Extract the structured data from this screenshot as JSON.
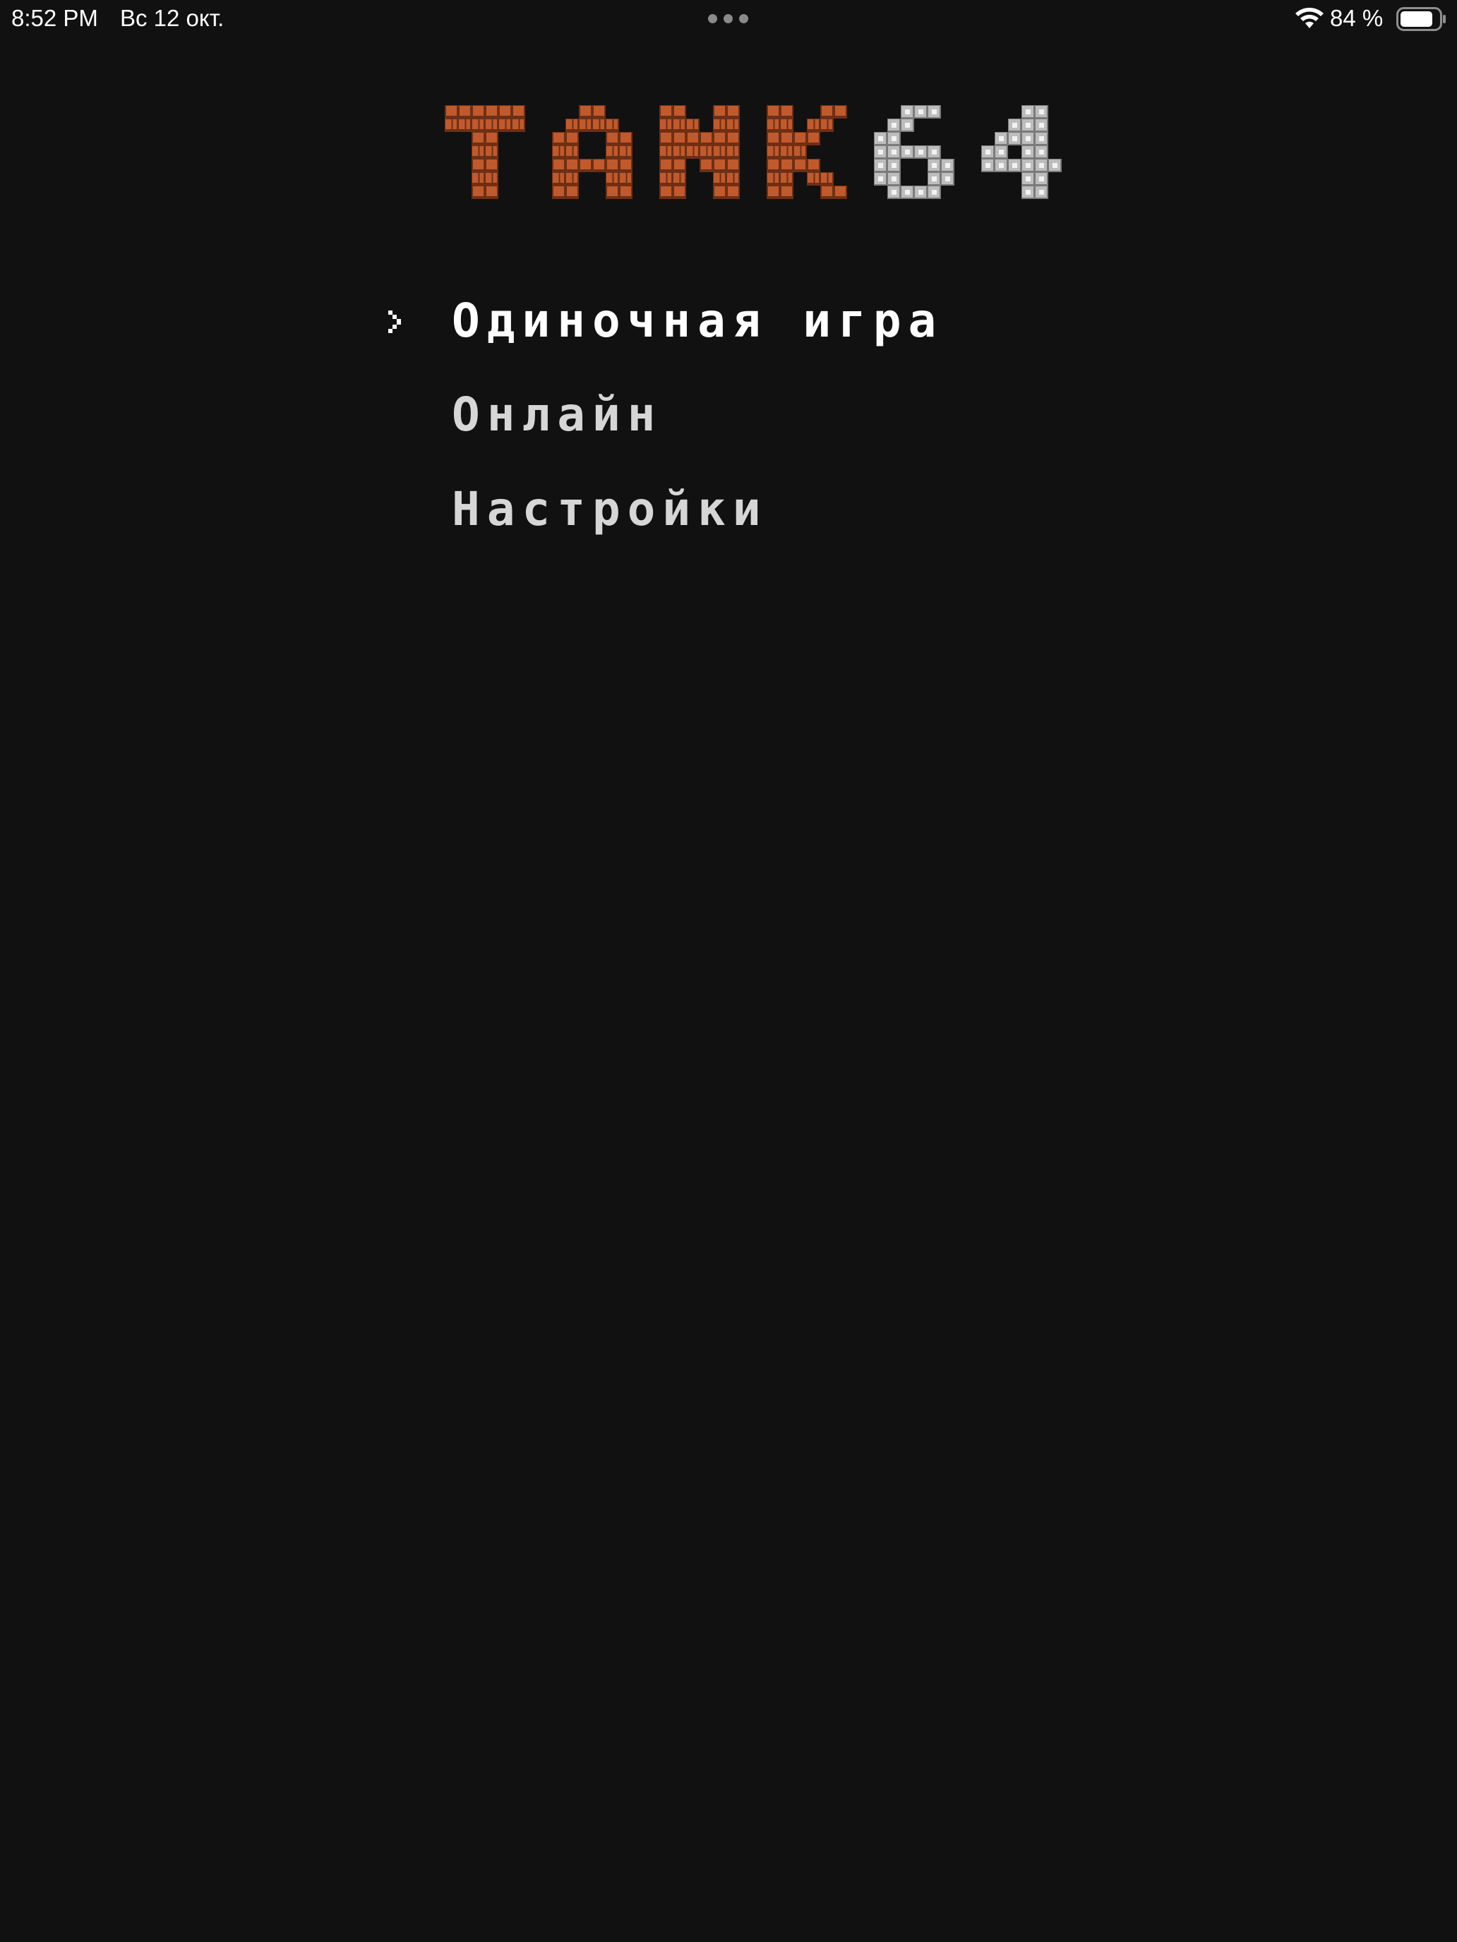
{
  "status_bar": {
    "time": "8:52 PM",
    "date": "Вс 12 окт.",
    "battery_percent": "84 %",
    "battery_level": 0.84,
    "icons": [
      "multitasking-dots-icon",
      "wifi-icon",
      "battery-icon"
    ]
  },
  "logo": {
    "text": "TANK64",
    "colors": {
      "brick": "#c05a2c",
      "brick_shadow": "#6e2f14",
      "steel": "#bdbdbd",
      "steel_highlight": "#f2f2f2"
    }
  },
  "menu": {
    "items": [
      {
        "label": "Одиночная игра",
        "selected": true
      },
      {
        "label": "Онлайн",
        "selected": false
      },
      {
        "label": "Настройки",
        "selected": false
      }
    ],
    "cursor_icon": "chevron-right-icon"
  },
  "colors": {
    "background": "#111111",
    "text_selected": "#ffffff",
    "text_normal": "#d6d6d6"
  }
}
